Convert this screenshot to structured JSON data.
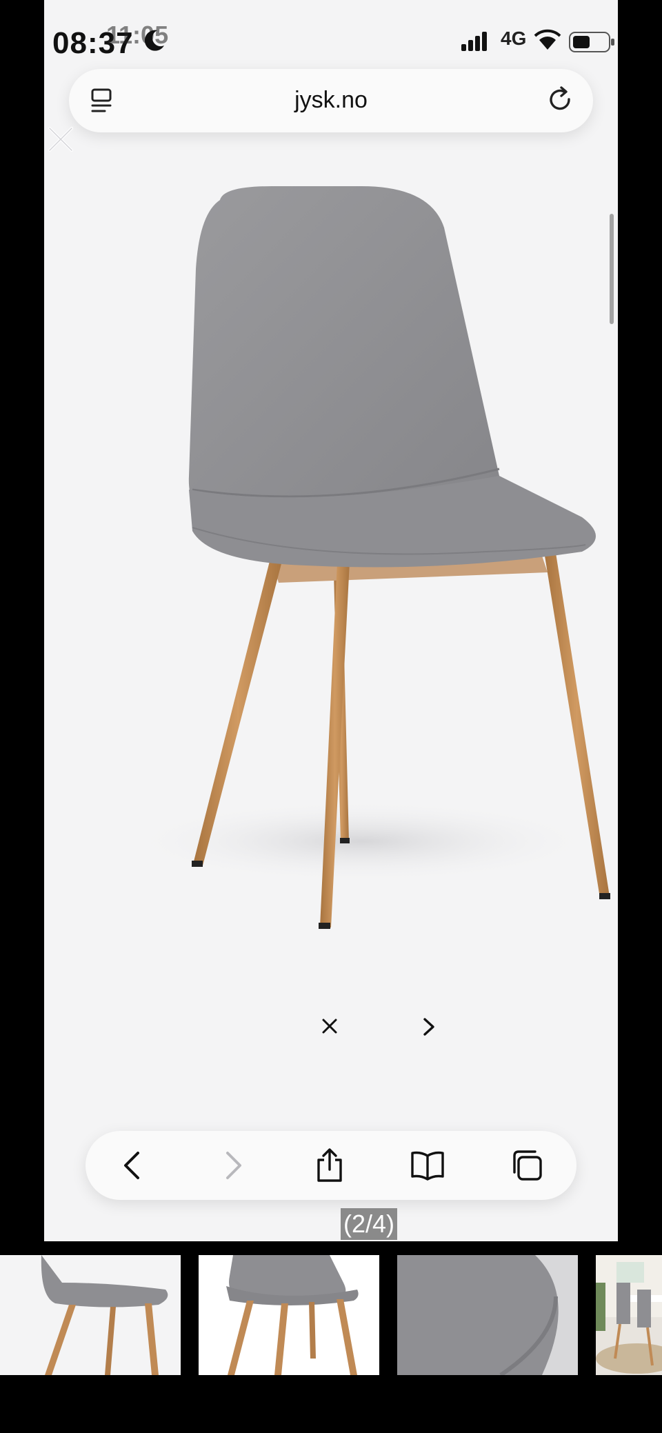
{
  "status_bar": {
    "time": "08:37",
    "time_overlay": "11:05",
    "network": "4G"
  },
  "browser": {
    "url": "jysk.no",
    "icons": {
      "reader": "reader-view-icon",
      "reload": "reload-icon",
      "back": "chevron-left-icon",
      "forward": "chevron-right-icon",
      "share": "share-icon",
      "bookmarks": "book-icon",
      "tabs": "tabs-icon"
    }
  },
  "gallery": {
    "counter": "(2/4)",
    "current_index": 2,
    "total": 4,
    "close_symbol": "×",
    "next_icon": "chevron-right-icon"
  },
  "colors": {
    "page_bg": "#f4f4f5",
    "upholstery": "#8f8f92",
    "legs": "#c08a55"
  }
}
